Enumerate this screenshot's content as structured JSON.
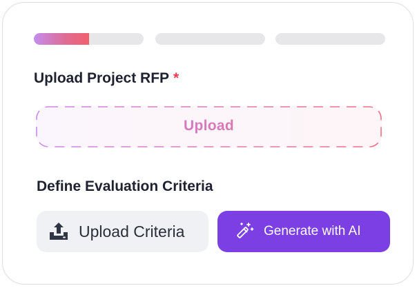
{
  "progress": {
    "steps_total": 3,
    "current_step": 1,
    "step1_fill_fraction": 0.5
  },
  "upload_section": {
    "label": "Upload Project RFP",
    "required_marker": "*",
    "dropzone_text": "Upload"
  },
  "criteria_section": {
    "label": "Define Evaluation Criteria",
    "upload_button_label": "Upload Criteria",
    "upload_button_icon": "upload-icon",
    "ai_button_label": "Generate with AI",
    "ai_button_icon": "magic-wand-icon"
  },
  "colors": {
    "accent_purple": "#7b3fe4",
    "required_red": "#ef3b4f",
    "gradient_start": "#c48cf0",
    "gradient_end": "#f26070"
  }
}
